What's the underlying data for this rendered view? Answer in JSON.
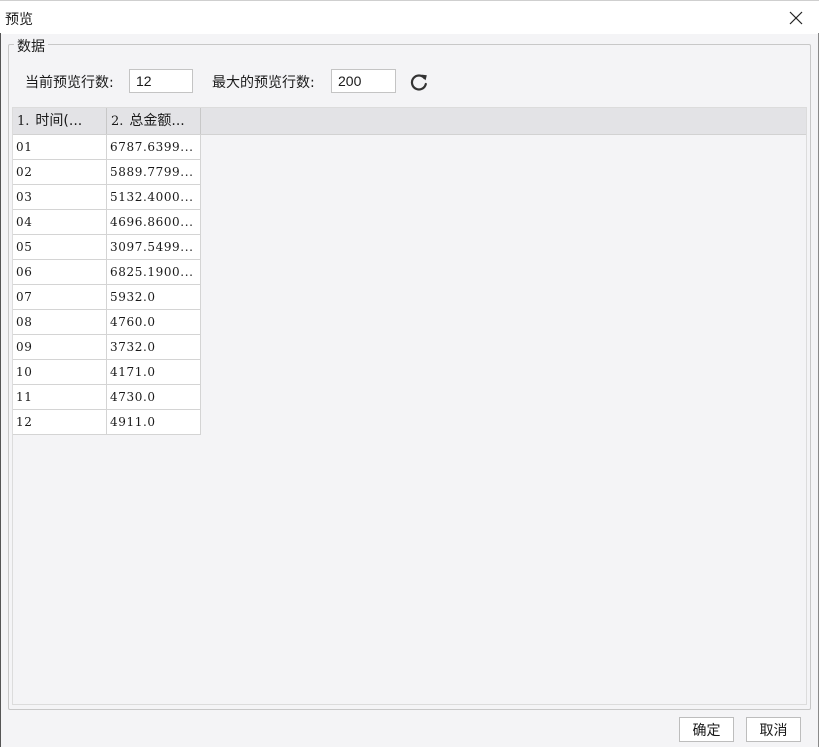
{
  "window": {
    "title": "预览"
  },
  "group": {
    "legend": "数据"
  },
  "controls": {
    "current_rows_label": "当前预览行数:",
    "current_rows_value": "12",
    "max_rows_label": "最大的预览行数:",
    "max_rows_value": "200",
    "refresh_icon": "refresh-icon"
  },
  "table": {
    "columns": [
      {
        "index": "1.",
        "label": "时间(..."
      },
      {
        "index": "2.",
        "label": "总金额..."
      }
    ],
    "rows": [
      [
        "01",
        "6787.6399..."
      ],
      [
        "02",
        "5889.7799..."
      ],
      [
        "03",
        "5132.4000..."
      ],
      [
        "04",
        "4696.8600..."
      ],
      [
        "05",
        "3097.5499..."
      ],
      [
        "06",
        "6825.1900..."
      ],
      [
        "07",
        "5932.0"
      ],
      [
        "08",
        "4760.0"
      ],
      [
        "09",
        "3732.0"
      ],
      [
        "10",
        "4171.0"
      ],
      [
        "11",
        "4730.0"
      ],
      [
        "12",
        "4911.0"
      ]
    ]
  },
  "footer": {
    "ok_label": "确定",
    "cancel_label": "取消"
  }
}
